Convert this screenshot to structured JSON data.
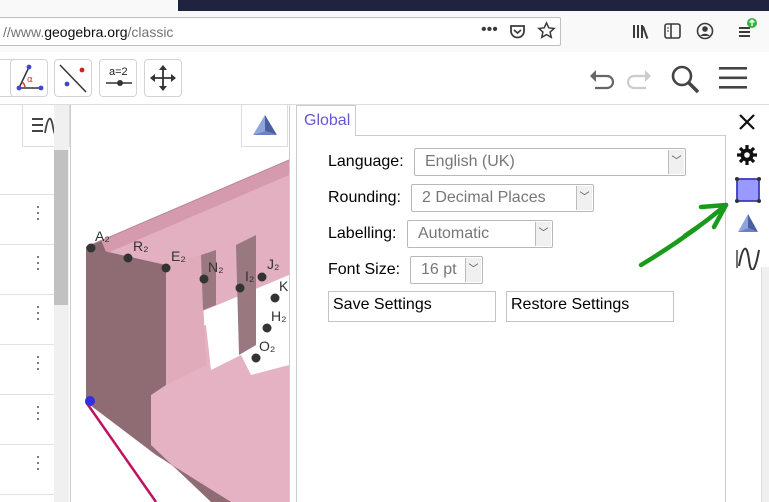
{
  "browser": {
    "url_dim": "//www.",
    "url_main": "geogebra.org",
    "url_path": "/classic"
  },
  "graphics": {
    "point_labels": [
      "A₂",
      "R₂",
      "E₂",
      "N₂",
      "I₂",
      "J₂",
      "K",
      "H₂",
      "O₂"
    ]
  },
  "properties": {
    "tab_label": "Global",
    "language_label": "Language:",
    "language_value": "English (UK)",
    "rounding_label": "Rounding:",
    "rounding_value": "2 Decimal Places",
    "labelling_label": "Labelling:",
    "labelling_value": "Automatic",
    "fontsize_label": "Font Size:",
    "fontsize_value": "16 pt",
    "save_label": "Save Settings",
    "restore_label": "Restore Settings"
  },
  "toolbar": {
    "slider_tool_text": "a=2"
  },
  "colors": {
    "accent": "#6557d2",
    "arrow_annotation": "#1a9a1a",
    "solid_face": "#d9a3b5",
    "solid_dark": "#8c6a73"
  }
}
